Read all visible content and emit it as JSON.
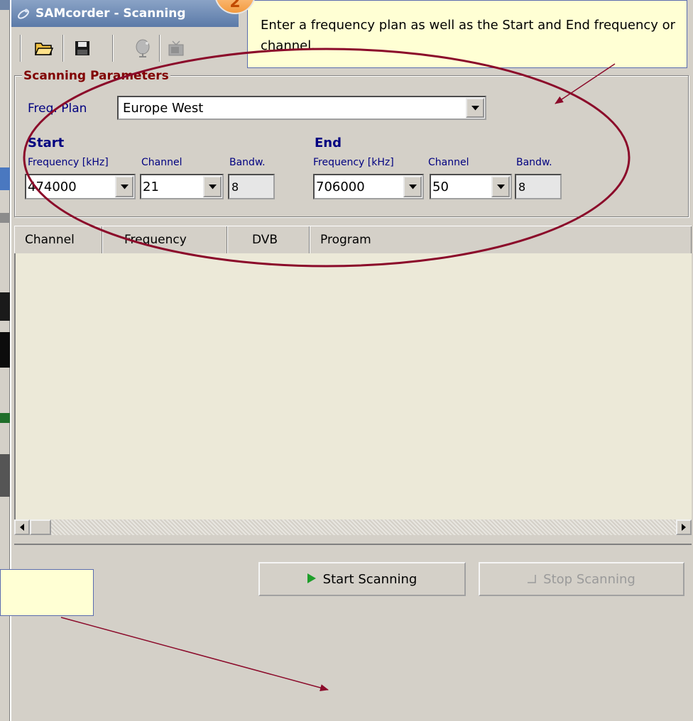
{
  "window": {
    "title": "SAMcorder - Scanning"
  },
  "toolbar": {
    "icons": [
      "open-folder-icon",
      "save-disk-icon",
      "satellite-dish-icon",
      "tv-icon"
    ]
  },
  "params": {
    "legend": "Scanning Parameters",
    "freq_plan_label": "Freq. Plan",
    "freq_plan_value": "Europe West",
    "start": {
      "title": "Start",
      "freq_label": "Frequency [kHz]",
      "channel_label": "Channel",
      "bandw_label": "Bandw.",
      "freq_value": "474000",
      "channel_value": "21",
      "bandw_value": "8"
    },
    "end": {
      "title": "End",
      "freq_label": "Frequency [kHz]",
      "channel_label": "Channel",
      "bandw_label": "Bandw.",
      "freq_value": "706000",
      "channel_value": "50",
      "bandw_value": "8"
    }
  },
  "list": {
    "columns": [
      "Channel",
      "Frequency",
      "DVB",
      "Program"
    ]
  },
  "buttons": {
    "start": "Start Scanning",
    "stop": "Stop Scanning"
  },
  "callouts": {
    "step_number": "2",
    "top_text": "Enter a frequency plan as well as the Start and End frequency or channel.",
    "bottom_text": ""
  },
  "colors": {
    "annotation": "#8b0a2a",
    "callout_bg": "#ffffd4",
    "legend_red": "#800000",
    "label_blue": "#000080"
  }
}
